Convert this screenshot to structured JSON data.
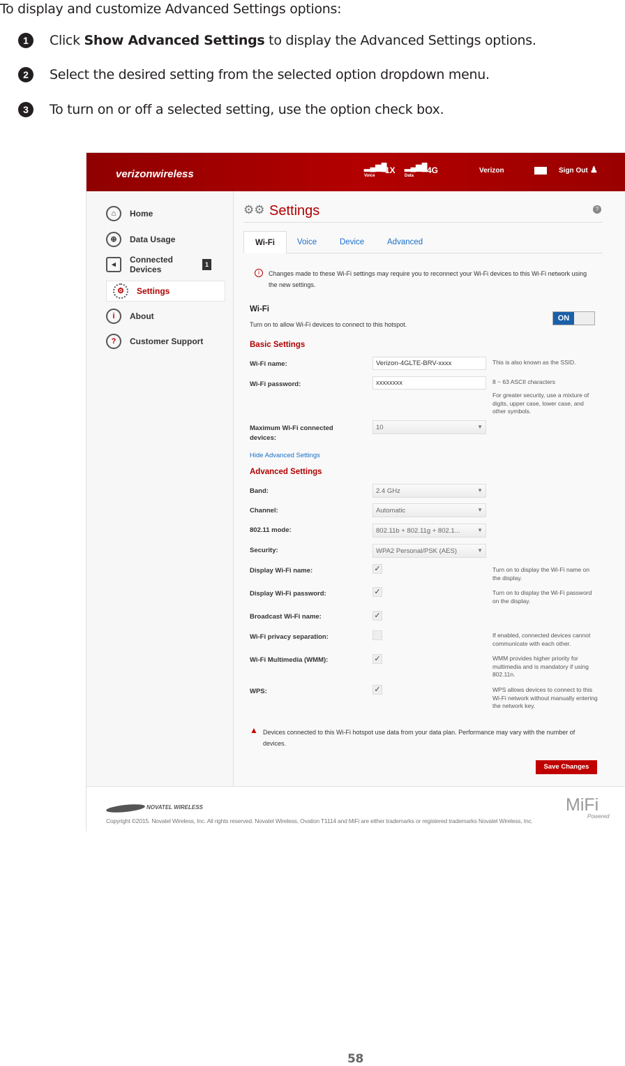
{
  "doc": {
    "intro": "To display and customize Advanced Settings options:",
    "steps": [
      {
        "num": "1",
        "pre": "Click ",
        "bold": "Show Advanced Settings",
        "post": " to display the Advanced Settings options."
      },
      {
        "num": "2",
        "text": "Select the desired setting from the selected option dropdown menu."
      },
      {
        "num": "3",
        "text": "To turn on or off a selected setting, use the  option check box."
      }
    ],
    "page_number": "58"
  },
  "header": {
    "brand": "verizonwireless",
    "voice_label": "Voice",
    "tech": "1X",
    "data_label": "Data",
    "network": "4G",
    "carrier": "Verizon",
    "sign_out": "Sign Out"
  },
  "sidebar": {
    "items": [
      {
        "label": "Home",
        "icon": "home-icon"
      },
      {
        "label": "Data Usage",
        "icon": "globe-icon"
      },
      {
        "label": "Connected Devices",
        "icon": "devices-icon",
        "badge": "1"
      },
      {
        "label": "Settings",
        "icon": "gear-icon",
        "active": true
      },
      {
        "label": "About",
        "icon": "info-icon"
      },
      {
        "label": "Customer Support",
        "icon": "support-icon"
      }
    ]
  },
  "main": {
    "title": "Settings",
    "tabs": [
      "Wi-Fi",
      "Voice",
      "Device",
      "Advanced"
    ],
    "notice": "Changes made to these Wi-Fi settings may require you to reconnect your Wi-Fi devices to this Wi-Fi network using the new settings.",
    "wifi_title": "Wi-Fi",
    "wifi_desc": "Turn on to allow Wi-Fi devices to connect to this hotspot.",
    "toggle": "ON",
    "basic_title": "Basic Settings",
    "name_label": "Wi-Fi name:",
    "name_value": "Verizon-4GLTE-BRV-xxxx",
    "name_hint": "This is also known as the SSID.",
    "pw_label": "Wi-Fi password:",
    "pw_value": "xxxxxxxx",
    "pw_hint": "8 ~ 63 ASCII characters",
    "pw_hint2": "For greater security, use a mixture of digits, upper case, lower case, and other symbols.",
    "max_label": "Maximum Wi-Fi connected devices:",
    "max_value": "10",
    "hide_link": "Hide Advanced Settings",
    "adv_title": "Advanced Settings",
    "band_label": "Band:",
    "band_value": "2.4 GHz",
    "channel_label": "Channel:",
    "channel_value": "Automatic",
    "mode_label": "802.11 mode:",
    "mode_value": "802.11b + 802.11g + 802.1...",
    "sec_label": "Security:",
    "sec_value": "WPA2 Personal/PSK (AES)",
    "checks": [
      {
        "label": "Display Wi-Fi name:",
        "checked": true,
        "hint": "Turn on to display the Wi-Fi name on the display."
      },
      {
        "label": "Display Wi-Fi password:",
        "checked": true,
        "hint": "Turn on to display the Wi-Fi password on the display."
      },
      {
        "label": "Broadcast Wi-Fi name:",
        "checked": true,
        "hint": ""
      },
      {
        "label": "Wi-Fi privacy separation:",
        "checked": false,
        "hint": "If enabled, connected devices cannot communicate with each other."
      },
      {
        "label": "Wi-Fi Multimedia (WMM):",
        "checked": true,
        "hint": "WMM provides higher priority for multimedia and is mandatory if using 802.11n."
      },
      {
        "label": "WPS:",
        "checked": true,
        "hint": "WPS allows devices to connect to this Wi-Fi network without manually entering the network key."
      }
    ],
    "warning": "Devices connected to this Wi-Fi hotspot use data from your data plan. Performance may vary with the number of devices.",
    "save": "Save Changes"
  },
  "footer": {
    "logo": "NOVATEL WIRELESS",
    "copyright": "Copyright ©2015. Novatel Wireless, Inc. All rights reserved. Novatel Wireless, Ovation T1114 and MiFi are either trademarks or registered trademarks Novatel Wireless, Inc.",
    "mifi": "MiFi",
    "powered": "Powered"
  },
  "colors": {
    "brand_red": "#a80000",
    "link_blue": "#1a6fc9",
    "save_red": "#c00000"
  }
}
